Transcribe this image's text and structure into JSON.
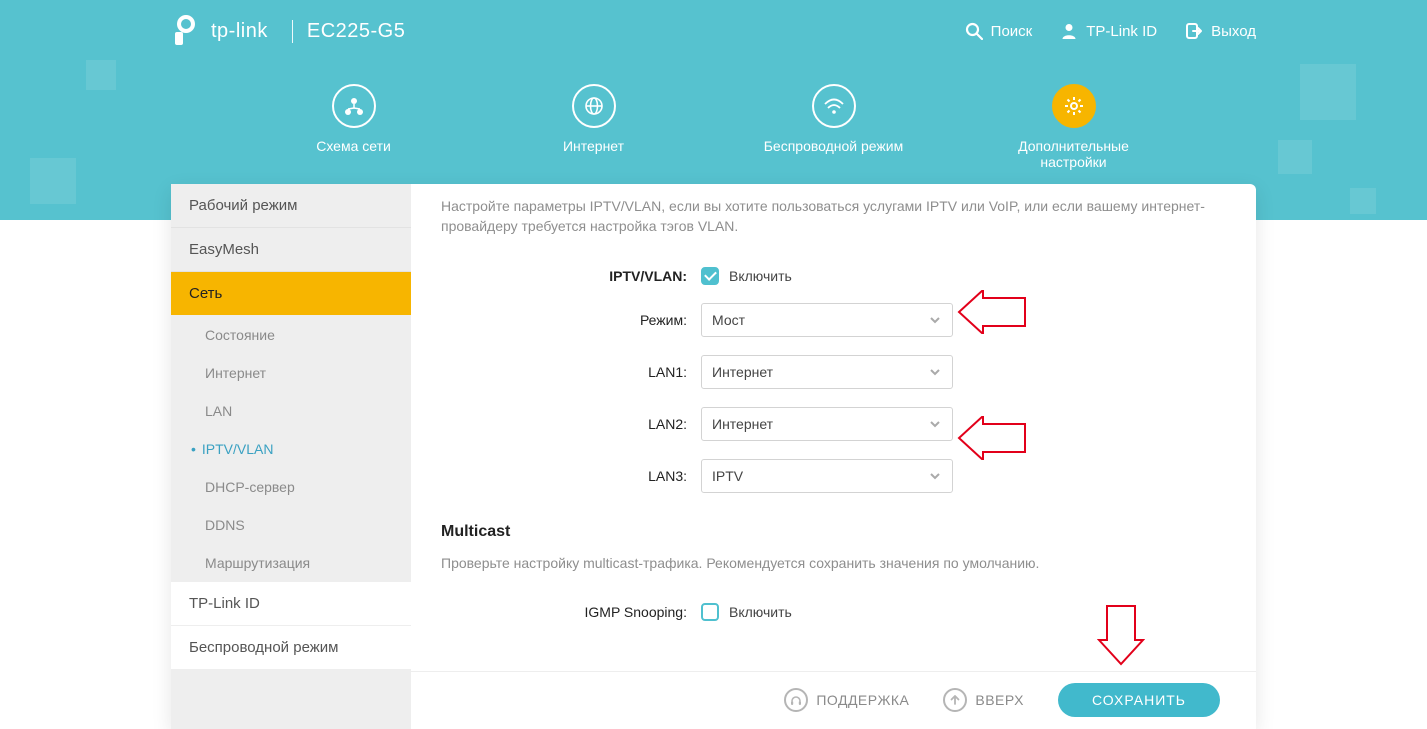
{
  "brand": "tp-link",
  "model": "EC225-G5",
  "topbar": {
    "search": "Поиск",
    "tplink_id": "TP-Link ID",
    "logout": "Выход"
  },
  "nav": {
    "network_map": "Схема сети",
    "internet": "Интернет",
    "wireless": "Беспроводной режим",
    "advanced": "Дополнительные настройки"
  },
  "sidebar": {
    "mode": "Рабочий режим",
    "easymesh": "EasyMesh",
    "network": "Сеть",
    "subs": {
      "status": "Состояние",
      "internet": "Интернет",
      "lan": "LAN",
      "iptv": "IPTV/VLAN",
      "dhcp": "DHCP-сервер",
      "ddns": "DDNS",
      "routing": "Маршрутизация"
    },
    "tplink_id": "TP-Link ID",
    "wireless": "Беспроводной режим"
  },
  "iptv": {
    "description": "Настройте параметры IPTV/VLAN, если вы хотите пользоваться услугами IPTV или VoIP, или если вашему интернет-провайдеру требуется настройка тэгов VLAN.",
    "label_main": "IPTV/VLAN:",
    "enable": "Включить",
    "mode_label": "Режим:",
    "mode_value": "Мост",
    "lan1_label": "LAN1:",
    "lan1_value": "Интернет",
    "lan2_label": "LAN2:",
    "lan2_value": "Интернет",
    "lan3_label": "LAN3:",
    "lan3_value": "IPTV"
  },
  "multicast": {
    "heading": "Multicast",
    "description": "Проверьте настройку multicast-трафика. Рекомендуется сохранить значения по умолчанию.",
    "igmp_label": "IGMP Snooping:",
    "igmp_enable": "Включить"
  },
  "footer": {
    "support": "ПОДДЕРЖКА",
    "top": "ВВЕРХ",
    "save": "СОХРАНИТЬ"
  }
}
